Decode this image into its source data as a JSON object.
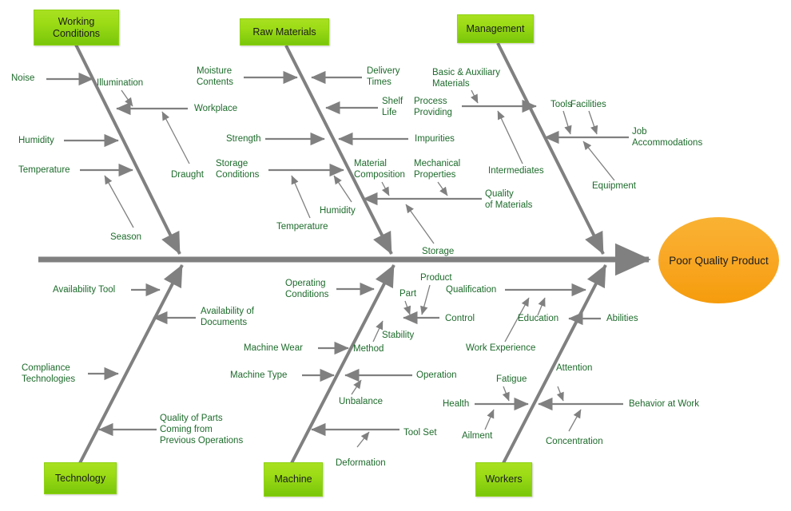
{
  "diagram": {
    "type": "ishikawa-fishbone",
    "title": "Poor Quality Product",
    "effect": {
      "label": "Poor Quality\nProduct",
      "color": "#f9a826"
    },
    "category_color": "#8fd312",
    "label_color": "#1d6b2b",
    "bone_color": "#808080",
    "categories": [
      {
        "name": "Working Conditions",
        "label": "Working\nConditions",
        "position": "top-left"
      },
      {
        "name": "Raw Materials",
        "label": "Raw Materials",
        "position": "top-center"
      },
      {
        "name": "Management",
        "label": "Management",
        "position": "top-right"
      },
      {
        "name": "Technology",
        "label": "Technology",
        "position": "bottom-left"
      },
      {
        "name": "Machine",
        "label": "Machine",
        "position": "bottom-center"
      },
      {
        "name": "Workers",
        "label": "Workers",
        "position": "bottom-right"
      }
    ],
    "causes": {
      "working_conditions": [
        "Noise",
        "Illumination",
        "Workplace",
        "Draught",
        "Humidity",
        "Temperature",
        "Season"
      ],
      "raw_materials": [
        "Moisture\nContents",
        "Delivery\nTimes",
        "Shelf\nLife",
        "Strength",
        "Impurities",
        "Storage\nConditions",
        "Material\nComposition",
        "Mechanical\nProperties",
        "Quality\nof Materials",
        "Humidity",
        "Temperature",
        "Storage"
      ],
      "management": [
        "Basic & Auxiliary\nMaterials",
        "Process\nProviding",
        "Intermediates",
        "Tools",
        "Facilities",
        "Job\nAccommodations",
        "Equipment"
      ],
      "technology": [
        "Availability Tool",
        "Availability of\nDocuments",
        "Compliance\nTechnologies",
        "Quality of Parts\nComing from\nPrevious Operations"
      ],
      "machine": [
        "Operating\nConditions",
        "Part",
        "Product",
        "Control",
        "Method",
        "Stability",
        "Machine Wear",
        "Machine Type",
        "Operation",
        "Unbalance",
        "Tool Set",
        "Deformation"
      ],
      "workers": [
        "Qualification",
        "Education",
        "Work Experience",
        "Abilities",
        "Fatigue",
        "Attention",
        "Health",
        "Behavior at Work",
        "Ailment",
        "Concentration"
      ]
    }
  },
  "labels": {
    "noise": "Noise",
    "illumination": "Illumination",
    "workplace": "Workplace",
    "draught": "Draught",
    "humidity_wc": "Humidity",
    "temperature_wc": "Temperature",
    "season": "Season",
    "moisture_contents": "Moisture\nContents",
    "delivery_times": "Delivery\nTimes",
    "shelf_life": "Shelf\nLife",
    "strength": "Strength",
    "impurities": "Impurities",
    "storage_conditions": "Storage\nConditions",
    "material_composition": "Material\nComposition",
    "mechanical_properties": "Mechanical\nProperties",
    "quality_of_materials": "Quality\nof Materials",
    "humidity_rm": "Humidity",
    "temperature_rm": "Temperature",
    "storage": "Storage",
    "basic_auxiliary_materials": "Basic & Auxiliary\nMaterials",
    "process_providing": "Process\nProviding",
    "intermediates": "Intermediates",
    "tools": "Tools",
    "facilities": "Facilities",
    "job_accommodations": "Job\nAccommodations",
    "equipment": "Equipment",
    "availability_tool": "Availability Tool",
    "availability_documents": "Availability of\nDocuments",
    "compliance_technologies": "Compliance\nTechnologies",
    "quality_of_parts": "Quality of Parts\nComing from\nPrevious Operations",
    "operating_conditions": "Operating\nConditions",
    "part": "Part",
    "product": "Product",
    "control": "Control",
    "method": "Method",
    "stability": "Stability",
    "machine_wear": "Machine Wear",
    "machine_type": "Machine Type",
    "operation": "Operation",
    "unbalance": "Unbalance",
    "tool_set": "Tool Set",
    "deformation": "Deformation",
    "qualification": "Qualification",
    "education": "Education",
    "work_experience": "Work Experience",
    "abilities": "Abilities",
    "fatigue": "Fatigue",
    "attention": "Attention",
    "health": "Health",
    "behavior_at_work": "Behavior at Work",
    "ailment": "Ailment",
    "concentration": "Concentration"
  },
  "boxes": {
    "working_conditions": "Working\nConditions",
    "raw_materials": "Raw Materials",
    "management": "Management",
    "technology": "Technology",
    "machine": "Machine",
    "workers": "Workers",
    "effect": "Poor Quality\nProduct"
  }
}
